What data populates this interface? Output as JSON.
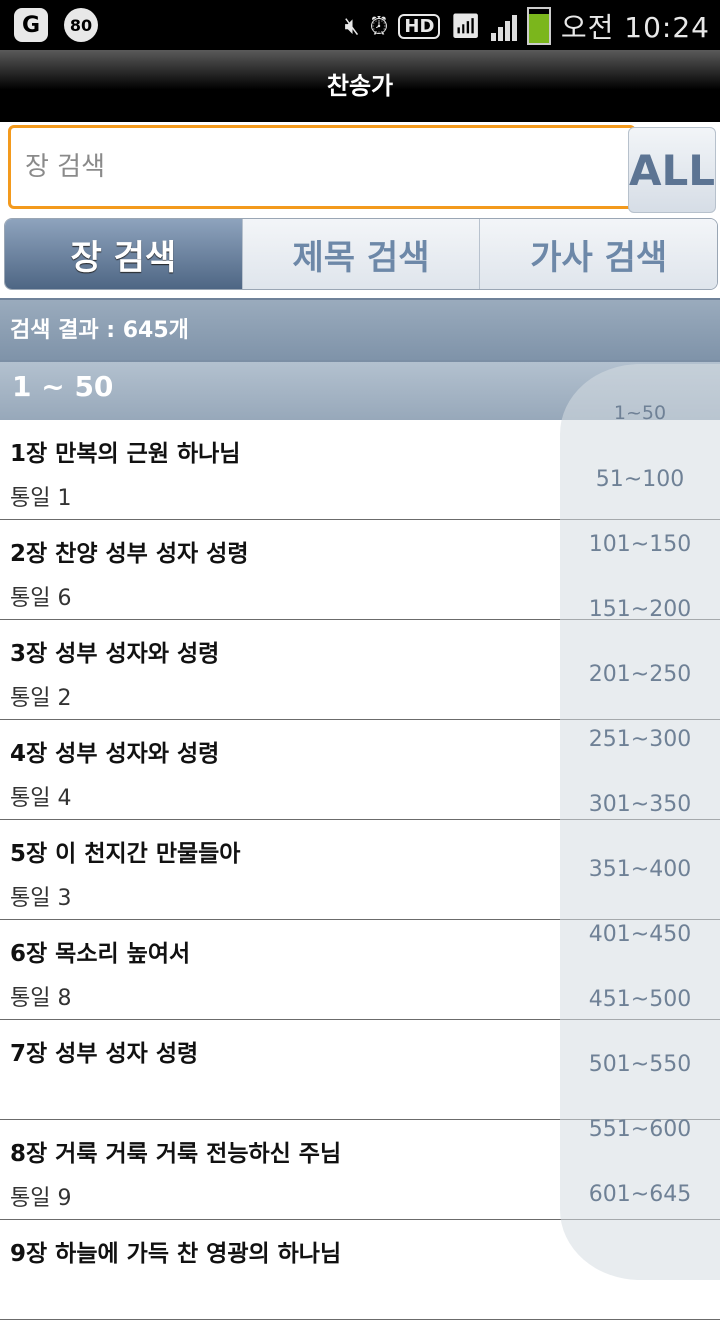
{
  "status_bar": {
    "app_icon_1": "G",
    "app_icon_2": "80",
    "hd_label": "HD",
    "time": "오전 10:24",
    "battery_level": 0.85
  },
  "title_bar": {
    "title": "찬송가"
  },
  "search": {
    "placeholder": "장 검색",
    "value": "",
    "all_button_label": "ALL"
  },
  "tabs": [
    {
      "label": "장 검색",
      "active": true
    },
    {
      "label": "제목 검색",
      "active": false
    },
    {
      "label": "가사 검색",
      "active": false
    }
  ],
  "results": {
    "count_text": "검색 결과 : 645개",
    "section_label": "1 ~ 50"
  },
  "hymns": [
    {
      "title": "1장 만복의 근원 하나님",
      "sub": "통일 1"
    },
    {
      "title": "2장 찬양 성부 성자 성령",
      "sub": "통일 6"
    },
    {
      "title": "3장 성부 성자와 성령",
      "sub": "통일 2"
    },
    {
      "title": "4장 성부 성자와 성령",
      "sub": "통일 4"
    },
    {
      "title": "5장 이 천지간 만물들아",
      "sub": "통일 3"
    },
    {
      "title": "6장 목소리 높여서",
      "sub": "통일 8"
    },
    {
      "title": "7장 성부 성자 성령",
      "sub": ""
    },
    {
      "title": "8장 거룩 거룩 거룩 전능하신 주님",
      "sub": "통일 9"
    },
    {
      "title": "9장 하늘에 가득 찬 영광의 하나님",
      "sub": ""
    }
  ],
  "index_ranges": [
    "1~50",
    "51~100",
    "101~150",
    "151~200",
    "201~250",
    "251~300",
    "301~350",
    "351~400",
    "401~450",
    "451~500",
    "501~550",
    "551~600",
    "601~645"
  ],
  "colors": {
    "accent_orange": "#f39a1d",
    "tab_active": "#5a7190",
    "header_blue": "#8fa2b6"
  }
}
